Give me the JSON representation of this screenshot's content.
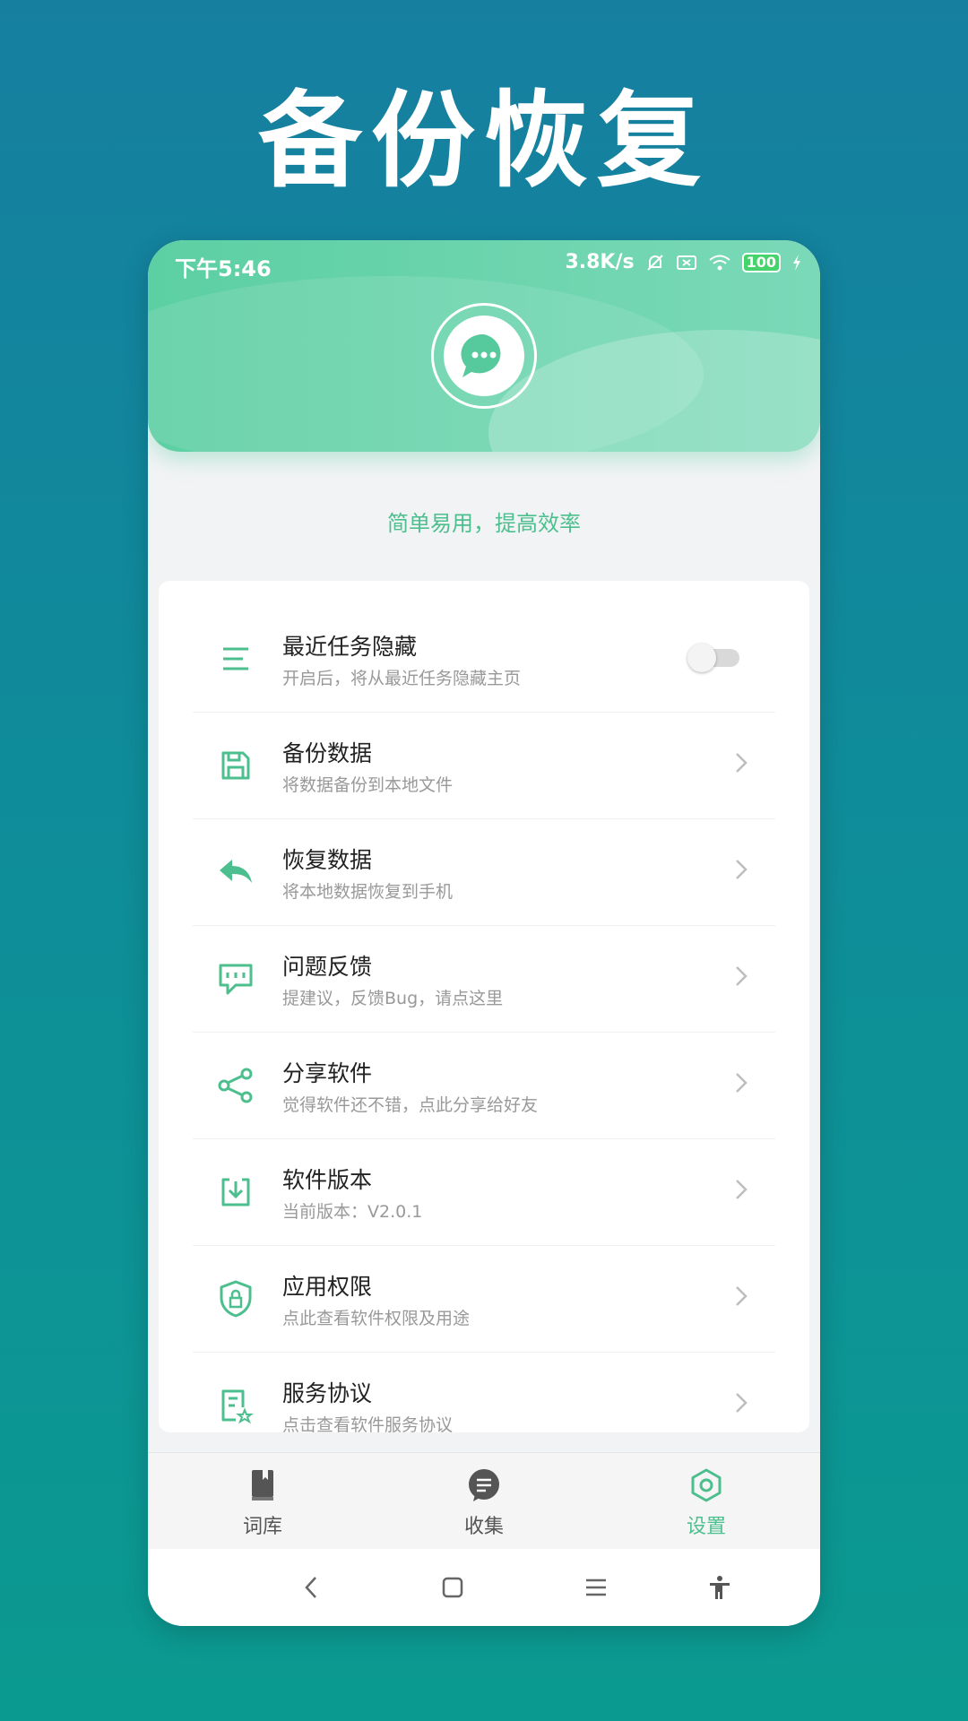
{
  "promo": {
    "title": "备份恢复"
  },
  "status_bar": {
    "time": "下午5:46",
    "speed": "3.8K/s",
    "battery": "100"
  },
  "tagline": "简单易用，提高效率",
  "settings": [
    {
      "title": "最近任务隐藏",
      "subtitle": "开启后，将从最近任务隐藏主页",
      "icon": "menu-lines-icon",
      "control": "toggle",
      "toggle_on": false
    },
    {
      "title": "备份数据",
      "subtitle": "将数据备份到本地文件",
      "icon": "floppy-save-icon",
      "control": "chevron"
    },
    {
      "title": "恢复数据",
      "subtitle": "将本地数据恢复到手机",
      "icon": "reply-arrow-icon",
      "control": "chevron"
    },
    {
      "title": "问题反馈",
      "subtitle": "提建议，反馈Bug，请点这里",
      "icon": "feedback-chat-icon",
      "control": "chevron"
    },
    {
      "title": "分享软件",
      "subtitle": "觉得软件还不错，点此分享给好友",
      "icon": "share-icon",
      "control": "chevron"
    },
    {
      "title": "软件版本",
      "subtitle": "当前版本：V2.0.1",
      "icon": "download-box-icon",
      "control": "chevron"
    },
    {
      "title": "应用权限",
      "subtitle": "点此查看软件权限及用途",
      "icon": "shield-lock-icon",
      "control": "chevron"
    },
    {
      "title": "服务协议",
      "subtitle": "点击查看软件服务协议",
      "icon": "agreement-doc-icon",
      "control": "chevron"
    }
  ],
  "bottom_nav": {
    "items": [
      {
        "label": "词库",
        "icon": "book-icon",
        "active": false
      },
      {
        "label": "收集",
        "icon": "message-bubble-icon",
        "active": false
      },
      {
        "label": "设置",
        "icon": "hexagon-settings-icon",
        "active": true
      }
    ]
  },
  "colors": {
    "accent": "#4dbf8e",
    "header_start": "#5ccfa3",
    "header_end": "#7bd9b8",
    "background_top": "#167fa0",
    "background_bottom": "#0b9a90"
  }
}
